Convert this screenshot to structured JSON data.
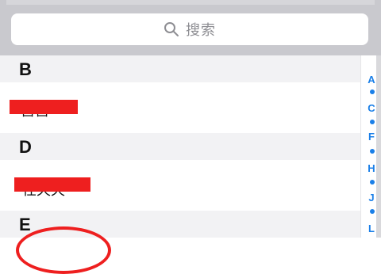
{
  "search": {
    "placeholder": "搜索",
    "icon": "magnifier"
  },
  "sections": [
    {
      "letter": "B",
      "rows": [
        {
          "text": "宫宫"
        }
      ]
    },
    {
      "letter": "D",
      "rows": [
        {
          "text": "任天天"
        }
      ]
    },
    {
      "letter": "E",
      "rows": []
    }
  ],
  "index": {
    "letters": [
      "A",
      "C",
      "F",
      "H",
      "J",
      "L"
    ]
  },
  "colors": {
    "accent": "#1a7fe8",
    "redaction": "#ee1f1f",
    "searchBackground": "#c9c9ce",
    "sectionHeader": "#f2f2f4"
  }
}
